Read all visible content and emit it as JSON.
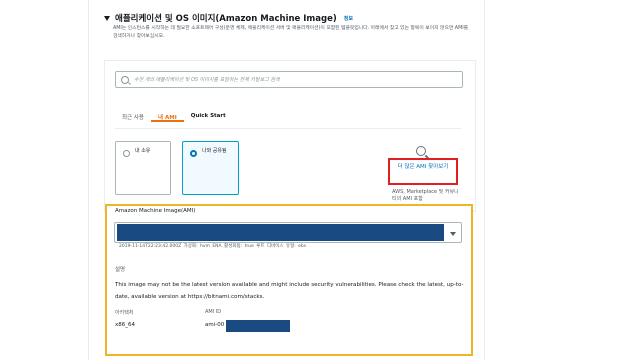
{
  "section": {
    "title": "애플리케이션 및 OS 이미지(Amazon Machine Image)",
    "info_link": "정보",
    "description": "AMI는 인스턴스를 시작하는 데 필요한 소프트웨어 구성(운영 체제, 애플리케이션 서버 및 애플리케이션)이 포함된 템플릿입니다. 아래에서 찾고 있는 항목이 보이지 않으면 AMI를 검색하거나 찾아보십시오."
  },
  "search": {
    "placeholder": "수천 개의 애플리케이션 및 OS 이미지를 포함하는 전체 카탈로그 검색"
  },
  "tabs": [
    {
      "label": "최근 사용",
      "active": false
    },
    {
      "label": "내 AMI",
      "active": true
    },
    {
      "label": "Quick Start",
      "active": false
    }
  ],
  "ownership_options": [
    {
      "label": "내 소유",
      "selected": false
    },
    {
      "label": "나와 공유됨",
      "selected": true
    }
  ],
  "browse": {
    "link_text": "더 많은 AMI 찾아보기",
    "subtext": "AWS, Marketplace 및 커뮤니티의 AMI 포함"
  },
  "ami": {
    "label": "Amazon Machine Image(AMI)",
    "meta": "2019-11-14T22:23:42.000Z   가상화: hvm   ENA 활성화됨: true   루트 디바이스 유형: ebs",
    "description_label": "설명",
    "description": "This image may not be the latest version available and might include security vulnerabilities. Please check the latest, up-to-date, available version at https://bitnami.com/stacks.",
    "architecture_label": "아키텍처",
    "architecture_value": "x86_64",
    "ami_id_label": "AMI ID",
    "ami_id_value": "ami-00"
  },
  "colors": {
    "accent_orange": "#ec7211",
    "link_blue": "#0073bb",
    "highlight_red": "#e02020",
    "highlight_yellow": "#f0b429",
    "redaction": "#1a4a82"
  }
}
